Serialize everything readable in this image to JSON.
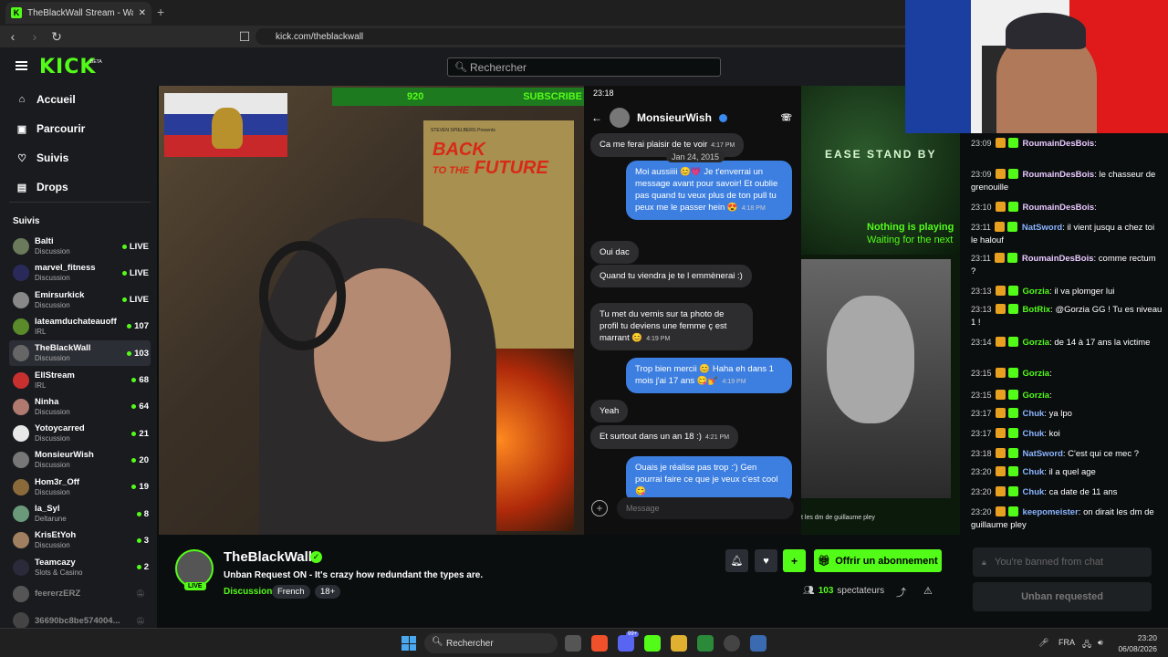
{
  "browser": {
    "tab_title": "TheBlackWall Stream - Watch",
    "tab_close": "✕",
    "new_tab": "+",
    "url": "kick.com/theblackwall"
  },
  "header": {
    "logo": "KICK",
    "logo_badge": "BETA",
    "search_placeholder": "Rechercher"
  },
  "sidebar": {
    "nav": [
      {
        "label": "Accueil",
        "icon": "home-icon"
      },
      {
        "label": "Parcourir",
        "icon": "browse-icon"
      },
      {
        "label": "Suivis",
        "icon": "heart-icon"
      },
      {
        "label": "Drops",
        "icon": "drops-icon"
      }
    ],
    "section_title": "Suivis",
    "channels": [
      {
        "name": "Balti",
        "category": "Discussion",
        "status": "LIVE",
        "color": "#6a7a5a"
      },
      {
        "name": "marvel_fitness",
        "category": "Discussion",
        "status": "LIVE",
        "color": "#2a2a5a"
      },
      {
        "name": "Emirsurkick",
        "category": "Discussion",
        "status": "LIVE",
        "color": "#888"
      },
      {
        "name": "lateamduchateauoff",
        "category": "IRL",
        "status": "107",
        "color": "#5a8a2a"
      },
      {
        "name": "TheBlackWall",
        "category": "Discussion",
        "status": "103",
        "color": "#666"
      },
      {
        "name": "EllStream",
        "category": "IRL",
        "status": "68",
        "color": "#c83030"
      },
      {
        "name": "Ninha",
        "category": "Discussion",
        "status": "64",
        "color": "#b07a70"
      },
      {
        "name": "Yotoycarred",
        "category": "Discussion",
        "status": "21",
        "color": "#e8e8e8"
      },
      {
        "name": "MonsieurWish",
        "category": "Discussion",
        "status": "20",
        "color": "#777"
      },
      {
        "name": "Hom3r_Off",
        "category": "Discussion",
        "status": "19",
        "color": "#8a6a3a"
      },
      {
        "name": "la_Syl",
        "category": "Deltarune",
        "status": "8",
        "color": "#6a9a7a"
      },
      {
        "name": "KrisEtYoh",
        "category": "Discussion",
        "status": "3",
        "color": "#a08060"
      },
      {
        "name": "Teamcazy",
        "category": "Slots & Casino",
        "status": "2",
        "color": "#2a2a3a"
      },
      {
        "name": "feererzERZ",
        "category": "",
        "status": "",
        "color": "#555"
      },
      {
        "name": "36690bc8be574004...",
        "category": "",
        "status": "",
        "color": "#444"
      }
    ]
  },
  "video": {
    "overlay_count": "920",
    "overlay_sub": "SUBSCRIBE",
    "poster_title_1": "BACK",
    "poster_title_2": "TO THE",
    "poster_title_3": "FUTURE",
    "poster_credit": "STEVEN SPIELBERG Presents",
    "phone": {
      "status_time": "23:18",
      "contact": "MonsieurWish",
      "messages": [
        {
          "dir": "in",
          "text": "Ca me ferai plaisir de te voir",
          "time": "4:17 PM"
        },
        {
          "dir": "out",
          "text": "Moi aussiiii 😊💗 Je t'enverrai un message avant pour savoir! Et oublie pas quand tu veux plus de ton pull tu peux me le passer hein 😍",
          "time": "4:18 PM"
        },
        {
          "dir": "in",
          "text": "Oui dac",
          "time": ""
        },
        {
          "dir": "in",
          "text": "Quand tu viendra je te l emmènerai :)",
          "time": ""
        },
        {
          "dir": "in",
          "text": "Tu met du vernis sur ta photo de profil tu deviens une femme ç est marrant 😊",
          "time": "4:19 PM"
        },
        {
          "dir": "out",
          "text": "Trop bien mercii 😊 Haha eh dans 1 mois j'ai 17 ans 😋💅",
          "time": "4:19 PM"
        },
        {
          "dir": "in",
          "text": "Yeah",
          "time": ""
        },
        {
          "dir": "in",
          "text": "Et surtout dans un an 18 :)",
          "time": "4:21 PM"
        },
        {
          "dir": "out",
          "text": "Ouais je réalise pas trop :') Gen pourrai faire ce que je veux c'est cool😋",
          "time": ""
        }
      ],
      "date_header": "Jan 24, 2015",
      "message_placeholder": "Message"
    },
    "standby_text": "EASE STAND BY",
    "nothing_playing": "Nothing is playing",
    "waiting": "Waiting for the next",
    "caption": "t les dm de guillaume pley"
  },
  "chat": {
    "messages": [
      {
        "time": "23:09",
        "user": "RoumainDesBois",
        "color": "#e8c8ff",
        "text": ""
      },
      {
        "time": "23:09",
        "user": "RoumainDesBois",
        "color": "#e8c8ff",
        "text": "le chasseur de grenouille"
      },
      {
        "time": "23:10",
        "user": "RoumainDesBois",
        "color": "#e8c8ff",
        "text": ""
      },
      {
        "time": "23:11",
        "user": "NatSword",
        "color": "#8ab4ff",
        "text": "il vient jusqu a chez toi le halouf"
      },
      {
        "time": "23:11",
        "user": "RoumainDesBois",
        "color": "#e8c8ff",
        "text": "comme rectum ?"
      },
      {
        "time": "23:13",
        "user": "Gorzia",
        "color": "#53fc18",
        "text": "il va plomger lui"
      },
      {
        "time": "23:13",
        "user": "BotRix",
        "color": "#53fc18",
        "text": "@Gorzia GG ! Tu es niveau 1 !"
      },
      {
        "time": "23:14",
        "user": "Gorzia",
        "color": "#53fc18",
        "text": "de 14 à 17 ans la victime"
      },
      {
        "time": "23:15",
        "user": "Gorzia",
        "color": "#53fc18",
        "text": ""
      },
      {
        "time": "23:15",
        "user": "Gorzia",
        "color": "#53fc18",
        "text": ""
      },
      {
        "time": "23:17",
        "user": "Chuk",
        "color": "#8ab4ff",
        "text": "ya lpo"
      },
      {
        "time": "23:17",
        "user": "Chuk",
        "color": "#8ab4ff",
        "text": "koi"
      },
      {
        "time": "23:18",
        "user": "NatSword",
        "color": "#8ab4ff",
        "text": "C'est qui ce mec ?"
      },
      {
        "time": "23:20",
        "user": "Chuk",
        "color": "#8ab4ff",
        "text": "il a quel age"
      },
      {
        "time": "23:20",
        "user": "Chuk",
        "color": "#8ab4ff",
        "text": "ca date de 11 ans"
      },
      {
        "time": "23:20",
        "user": "keepomeister",
        "color": "#8ab4ff",
        "text": "on dirait les dm de guillaume pley"
      }
    ],
    "input_placeholder": "You're banned from chat",
    "unban_label": "Unban requested"
  },
  "stream": {
    "name": "TheBlackWall",
    "live_badge": "LIVE",
    "title": "Unban Request ON - It's crazy how redundant the types are.",
    "category": "Discussion",
    "tags": [
      "French",
      "18+"
    ],
    "subscribe_label": "Offrir un abonnement",
    "viewers_count": "103",
    "viewers_label": "spectateurs"
  },
  "taskbar": {
    "search": "Rechercher",
    "lang": "FRA",
    "time": "23:20",
    "date": "06/08/2026",
    "badge": "99+"
  },
  "colors": {
    "accent": "#53fc18",
    "bg": "#0b0e0f",
    "panel": "#191b1f"
  }
}
